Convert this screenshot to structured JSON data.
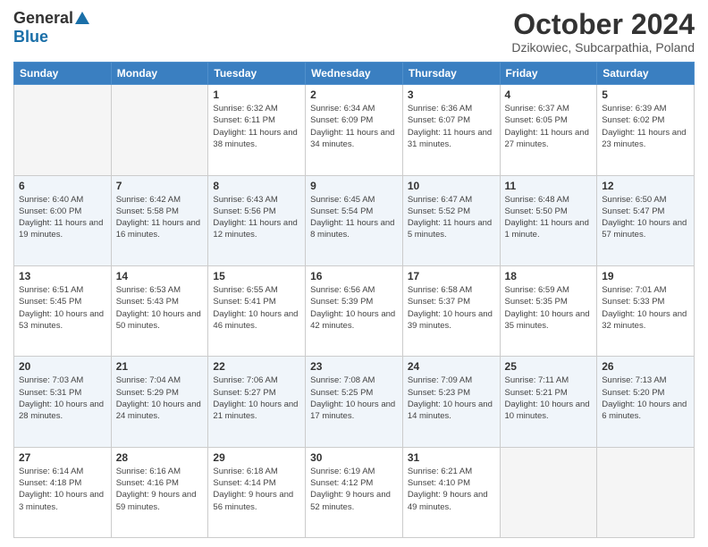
{
  "header": {
    "logo_general": "General",
    "logo_blue": "Blue",
    "title": "October 2024",
    "location": "Dzikowiec, Subcarpathia, Poland"
  },
  "weekdays": [
    "Sunday",
    "Monday",
    "Tuesday",
    "Wednesday",
    "Thursday",
    "Friday",
    "Saturday"
  ],
  "weeks": [
    [
      {
        "day": "",
        "info": ""
      },
      {
        "day": "",
        "info": ""
      },
      {
        "day": "1",
        "info": "Sunrise: 6:32 AM\nSunset: 6:11 PM\nDaylight: 11 hours and 38 minutes."
      },
      {
        "day": "2",
        "info": "Sunrise: 6:34 AM\nSunset: 6:09 PM\nDaylight: 11 hours and 34 minutes."
      },
      {
        "day": "3",
        "info": "Sunrise: 6:36 AM\nSunset: 6:07 PM\nDaylight: 11 hours and 31 minutes."
      },
      {
        "day": "4",
        "info": "Sunrise: 6:37 AM\nSunset: 6:05 PM\nDaylight: 11 hours and 27 minutes."
      },
      {
        "day": "5",
        "info": "Sunrise: 6:39 AM\nSunset: 6:02 PM\nDaylight: 11 hours and 23 minutes."
      }
    ],
    [
      {
        "day": "6",
        "info": "Sunrise: 6:40 AM\nSunset: 6:00 PM\nDaylight: 11 hours and 19 minutes."
      },
      {
        "day": "7",
        "info": "Sunrise: 6:42 AM\nSunset: 5:58 PM\nDaylight: 11 hours and 16 minutes."
      },
      {
        "day": "8",
        "info": "Sunrise: 6:43 AM\nSunset: 5:56 PM\nDaylight: 11 hours and 12 minutes."
      },
      {
        "day": "9",
        "info": "Sunrise: 6:45 AM\nSunset: 5:54 PM\nDaylight: 11 hours and 8 minutes."
      },
      {
        "day": "10",
        "info": "Sunrise: 6:47 AM\nSunset: 5:52 PM\nDaylight: 11 hours and 5 minutes."
      },
      {
        "day": "11",
        "info": "Sunrise: 6:48 AM\nSunset: 5:50 PM\nDaylight: 11 hours and 1 minute."
      },
      {
        "day": "12",
        "info": "Sunrise: 6:50 AM\nSunset: 5:47 PM\nDaylight: 10 hours and 57 minutes."
      }
    ],
    [
      {
        "day": "13",
        "info": "Sunrise: 6:51 AM\nSunset: 5:45 PM\nDaylight: 10 hours and 53 minutes."
      },
      {
        "day": "14",
        "info": "Sunrise: 6:53 AM\nSunset: 5:43 PM\nDaylight: 10 hours and 50 minutes."
      },
      {
        "day": "15",
        "info": "Sunrise: 6:55 AM\nSunset: 5:41 PM\nDaylight: 10 hours and 46 minutes."
      },
      {
        "day": "16",
        "info": "Sunrise: 6:56 AM\nSunset: 5:39 PM\nDaylight: 10 hours and 42 minutes."
      },
      {
        "day": "17",
        "info": "Sunrise: 6:58 AM\nSunset: 5:37 PM\nDaylight: 10 hours and 39 minutes."
      },
      {
        "day": "18",
        "info": "Sunrise: 6:59 AM\nSunset: 5:35 PM\nDaylight: 10 hours and 35 minutes."
      },
      {
        "day": "19",
        "info": "Sunrise: 7:01 AM\nSunset: 5:33 PM\nDaylight: 10 hours and 32 minutes."
      }
    ],
    [
      {
        "day": "20",
        "info": "Sunrise: 7:03 AM\nSunset: 5:31 PM\nDaylight: 10 hours and 28 minutes."
      },
      {
        "day": "21",
        "info": "Sunrise: 7:04 AM\nSunset: 5:29 PM\nDaylight: 10 hours and 24 minutes."
      },
      {
        "day": "22",
        "info": "Sunrise: 7:06 AM\nSunset: 5:27 PM\nDaylight: 10 hours and 21 minutes."
      },
      {
        "day": "23",
        "info": "Sunrise: 7:08 AM\nSunset: 5:25 PM\nDaylight: 10 hours and 17 minutes."
      },
      {
        "day": "24",
        "info": "Sunrise: 7:09 AM\nSunset: 5:23 PM\nDaylight: 10 hours and 14 minutes."
      },
      {
        "day": "25",
        "info": "Sunrise: 7:11 AM\nSunset: 5:21 PM\nDaylight: 10 hours and 10 minutes."
      },
      {
        "day": "26",
        "info": "Sunrise: 7:13 AM\nSunset: 5:20 PM\nDaylight: 10 hours and 6 minutes."
      }
    ],
    [
      {
        "day": "27",
        "info": "Sunrise: 6:14 AM\nSunset: 4:18 PM\nDaylight: 10 hours and 3 minutes."
      },
      {
        "day": "28",
        "info": "Sunrise: 6:16 AM\nSunset: 4:16 PM\nDaylight: 9 hours and 59 minutes."
      },
      {
        "day": "29",
        "info": "Sunrise: 6:18 AM\nSunset: 4:14 PM\nDaylight: 9 hours and 56 minutes."
      },
      {
        "day": "30",
        "info": "Sunrise: 6:19 AM\nSunset: 4:12 PM\nDaylight: 9 hours and 52 minutes."
      },
      {
        "day": "31",
        "info": "Sunrise: 6:21 AM\nSunset: 4:10 PM\nDaylight: 9 hours and 49 minutes."
      },
      {
        "day": "",
        "info": ""
      },
      {
        "day": "",
        "info": ""
      }
    ]
  ]
}
